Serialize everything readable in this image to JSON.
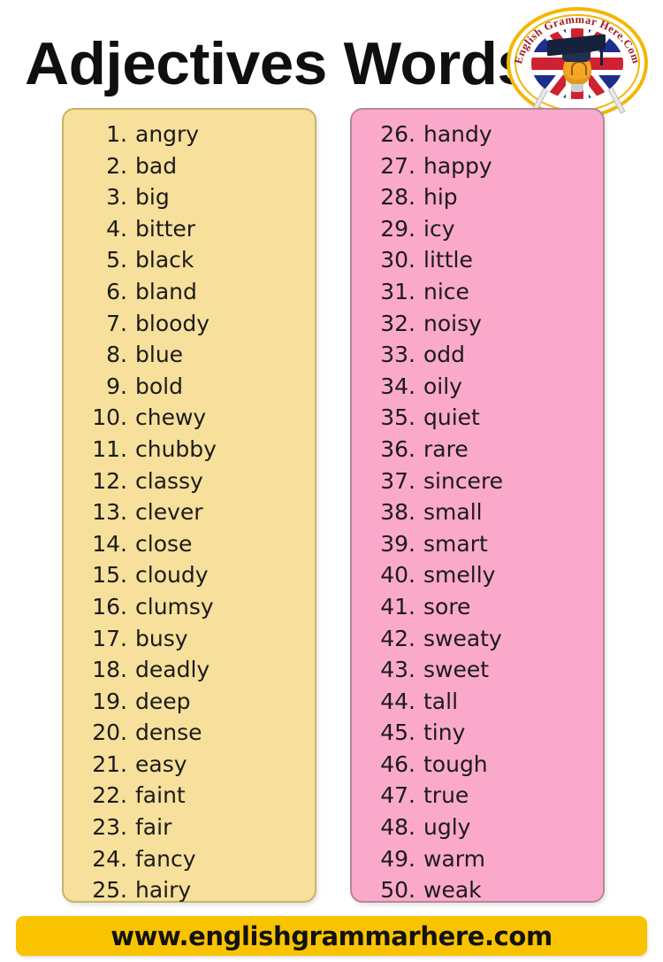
{
  "page": {
    "title": "Adjectives Words",
    "background_color": "#ffffff"
  },
  "logo": {
    "name": "english-grammar-here-logo",
    "text_top": "English Grammar",
    "text_bottom": "Here.Com",
    "full_text": "English Grammar Here.Com",
    "ring_color": "#f2b705",
    "text_color": "#a01b20",
    "flag": "uk-flag",
    "symbols": [
      "graduation-cap",
      "lightbulb",
      "pencil"
    ]
  },
  "columns": [
    {
      "name": "left-column",
      "background_color": "#f7e09b",
      "border_color": "#c9b268",
      "items": [
        {
          "num": "1.",
          "word": "angry"
        },
        {
          "num": "2.",
          "word": "bad"
        },
        {
          "num": "3.",
          "word": "big"
        },
        {
          "num": "4.",
          "word": "bitter"
        },
        {
          "num": "5.",
          "word": "black"
        },
        {
          "num": "6.",
          "word": "bland"
        },
        {
          "num": "7.",
          "word": "bloody"
        },
        {
          "num": "8.",
          "word": "blue"
        },
        {
          "num": "9.",
          "word": "bold"
        },
        {
          "num": "10.",
          "word": "chewy"
        },
        {
          "num": "11.",
          "word": "chubby"
        },
        {
          "num": "12.",
          "word": "classy"
        },
        {
          "num": "13.",
          "word": "clever"
        },
        {
          "num": "14.",
          "word": "close"
        },
        {
          "num": "15.",
          "word": "cloudy"
        },
        {
          "num": "16.",
          "word": "clumsy"
        },
        {
          "num": "17.",
          "word": "busy"
        },
        {
          "num": "18.",
          "word": "deadly"
        },
        {
          "num": "19.",
          "word": "deep"
        },
        {
          "num": "20.",
          "word": "dense"
        },
        {
          "num": "21.",
          "word": "easy"
        },
        {
          "num": "22.",
          "word": "faint"
        },
        {
          "num": "23.",
          "word": "fair"
        },
        {
          "num": "24.",
          "word": "fancy"
        },
        {
          "num": "25.",
          "word": "hairy"
        }
      ]
    },
    {
      "name": "right-column",
      "background_color": "#fba9cb",
      "border_color": "#b58798",
      "items": [
        {
          "num": "26.",
          "word": "handy"
        },
        {
          "num": "27.",
          "word": "happy"
        },
        {
          "num": "28.",
          "word": "hip"
        },
        {
          "num": "29.",
          "word": "icy"
        },
        {
          "num": "30.",
          "word": "little"
        },
        {
          "num": "31.",
          "word": "nice"
        },
        {
          "num": "32.",
          "word": "noisy"
        },
        {
          "num": "33.",
          "word": "odd"
        },
        {
          "num": "34.",
          "word": "oily"
        },
        {
          "num": "35.",
          "word": "quiet"
        },
        {
          "num": "36.",
          "word": "rare"
        },
        {
          "num": "37.",
          "word": "sincere"
        },
        {
          "num": "38.",
          "word": "small"
        },
        {
          "num": "39.",
          "word": "smart"
        },
        {
          "num": "40.",
          "word": "smelly"
        },
        {
          "num": "41.",
          "word": "sore"
        },
        {
          "num": "42.",
          "word": "sweaty"
        },
        {
          "num": "43.",
          "word": "sweet"
        },
        {
          "num": "44.",
          "word": "tall"
        },
        {
          "num": "45.",
          "word": "tiny"
        },
        {
          "num": "46.",
          "word": "tough"
        },
        {
          "num": "47.",
          "word": "true"
        },
        {
          "num": "48.",
          "word": "ugly"
        },
        {
          "num": "49.",
          "word": "warm"
        },
        {
          "num": "50.",
          "word": "weak"
        }
      ]
    }
  ],
  "footer": {
    "url": "www.englishgrammarhere.com",
    "background_color": "#f9c300",
    "text_color": "#121212"
  }
}
